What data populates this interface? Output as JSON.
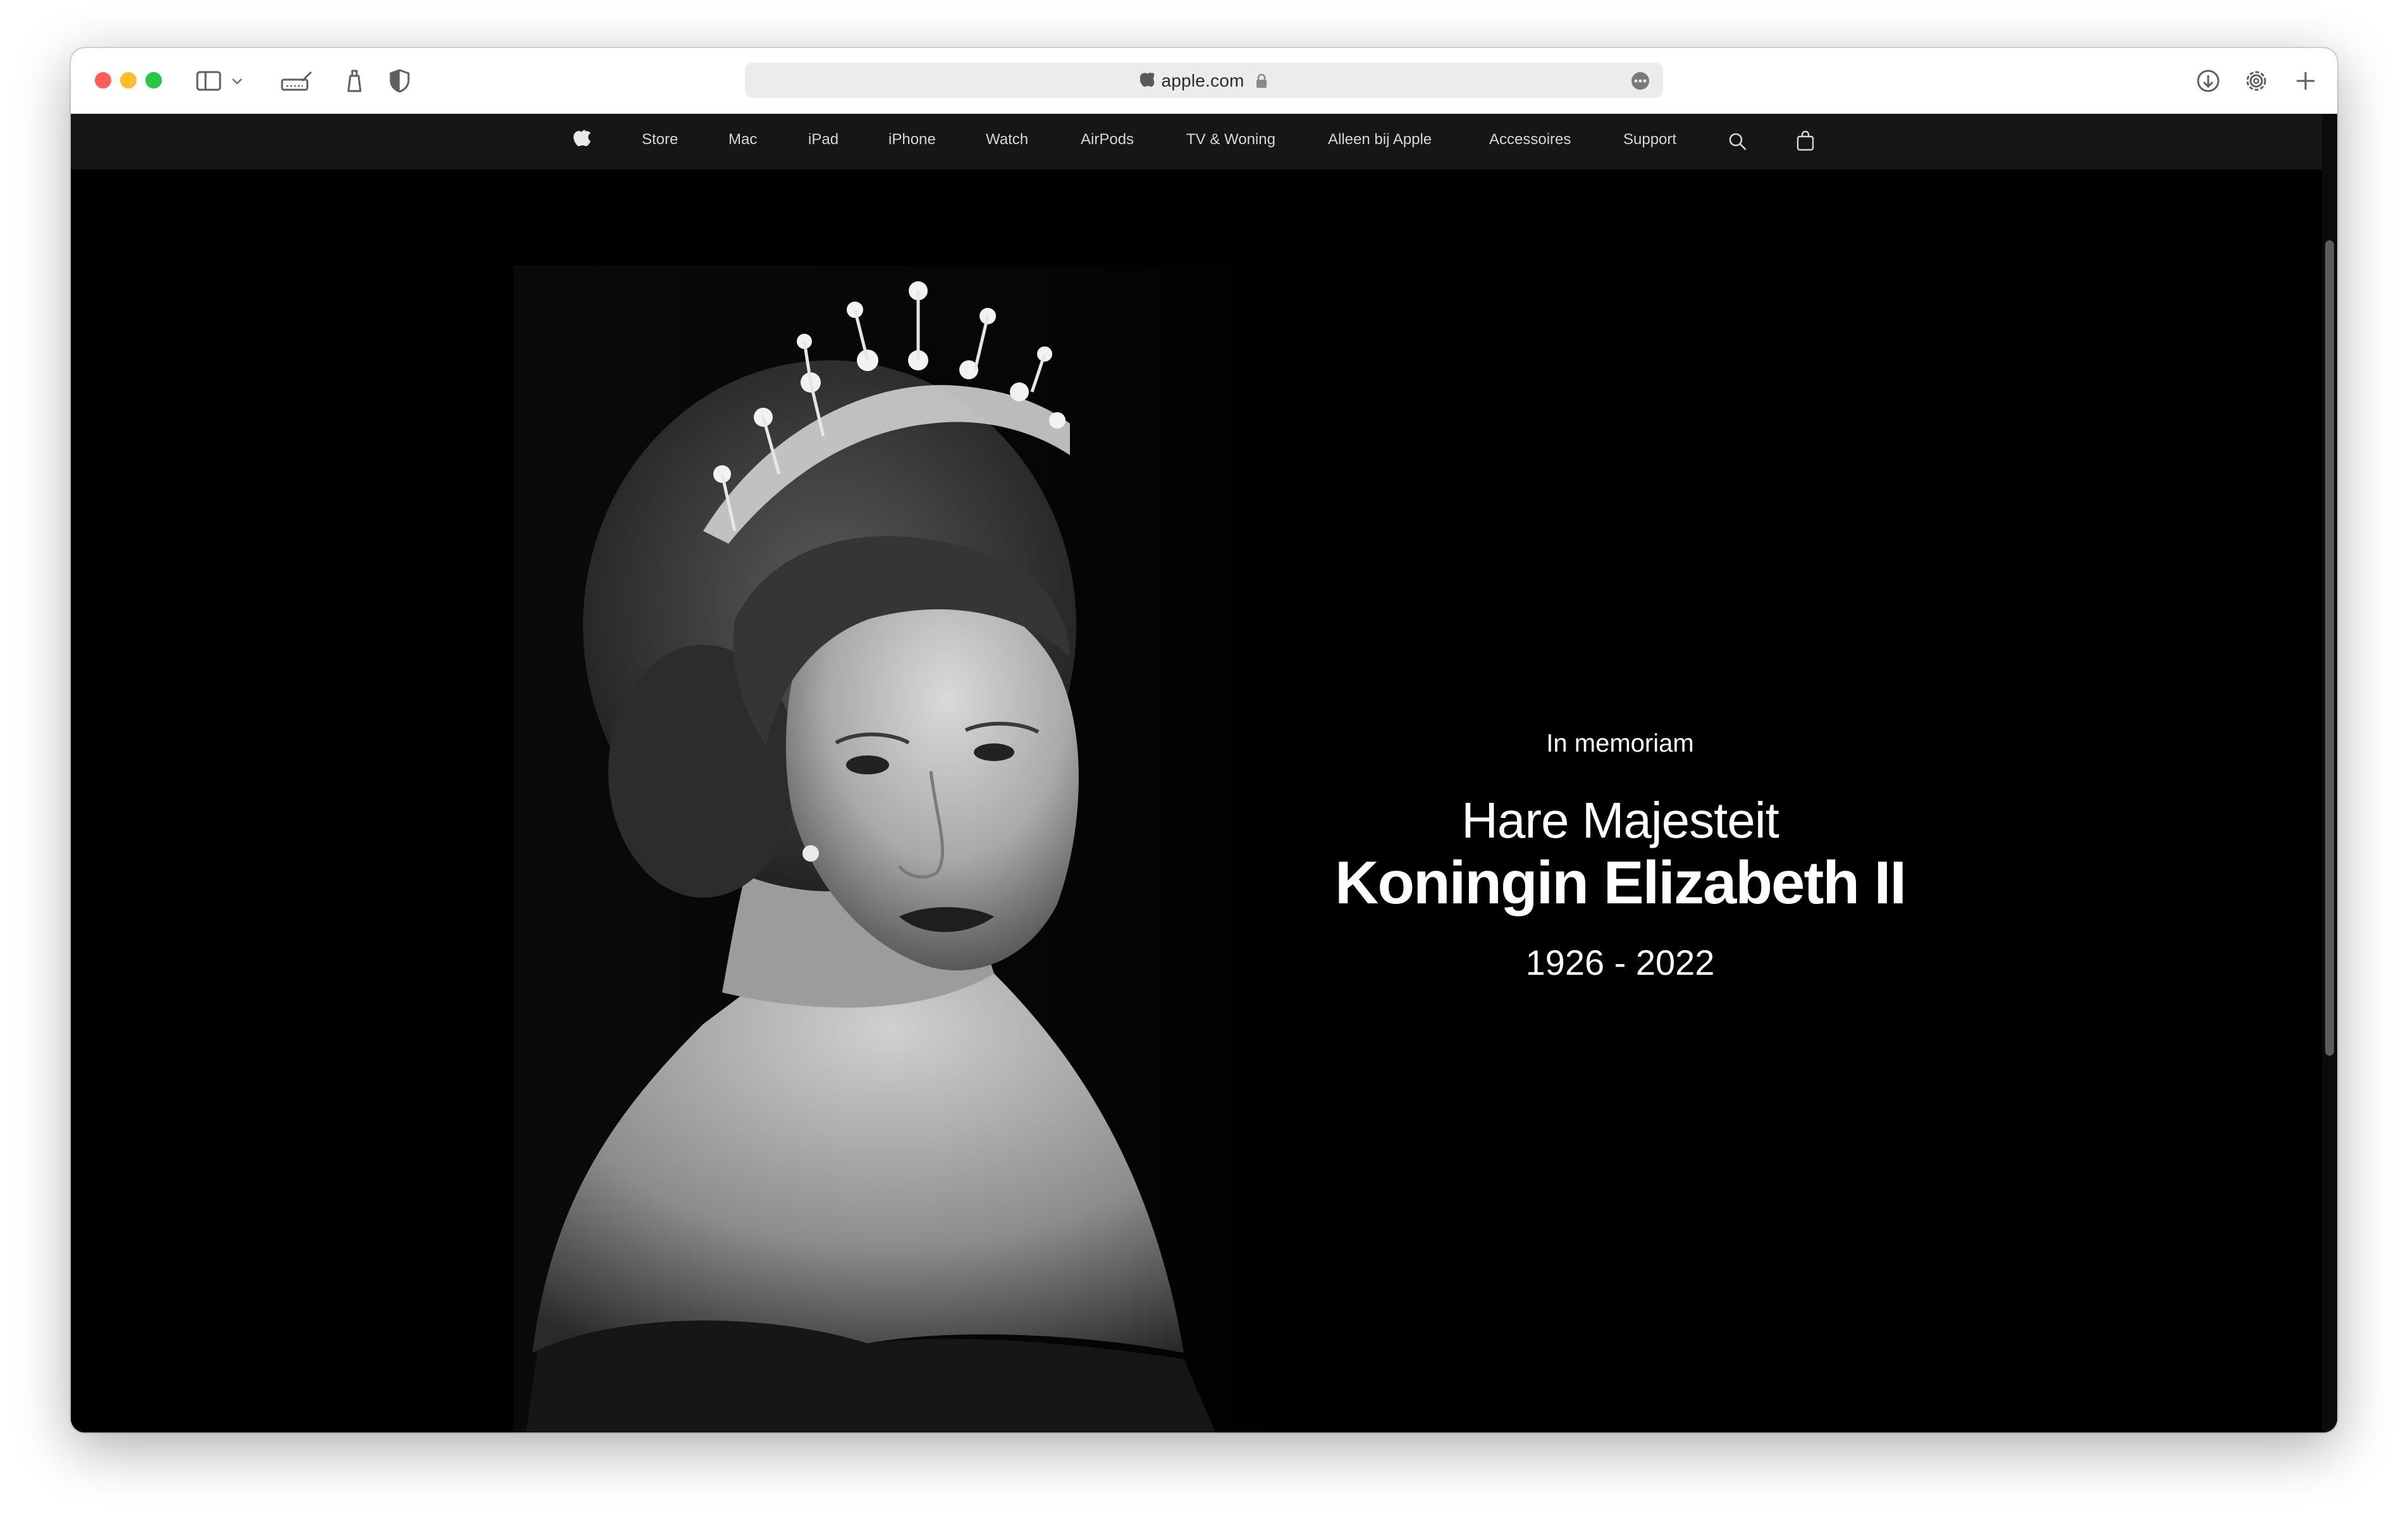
{
  "browser": {
    "url_domain": "apple.com",
    "traffic_lights": {
      "close": "#ff5f57",
      "minimize": "#febc2e",
      "zoom": "#28c840"
    },
    "icons": [
      "sidebar-icon",
      "chevron-down-icon",
      "tab-overview-icon",
      "broom-icon",
      "shield-icon",
      "apple-logo-icon",
      "lock-icon",
      "more-icon",
      "download-icon",
      "gear-icon",
      "plus-icon"
    ]
  },
  "nav": {
    "items": [
      "Store",
      "Mac",
      "iPad",
      "iPhone",
      "Watch",
      "AirPods",
      "TV & Woning",
      "Alleen bij Apple",
      "Accessoires",
      "Support"
    ],
    "icons": [
      "apple-logo-icon",
      "search-icon",
      "bag-icon"
    ]
  },
  "hero": {
    "eyebrow": "In memoriam",
    "line1": "Hare Majesteit",
    "line2": "Koningin Elizabeth II",
    "years": "1926 - 2022"
  }
}
